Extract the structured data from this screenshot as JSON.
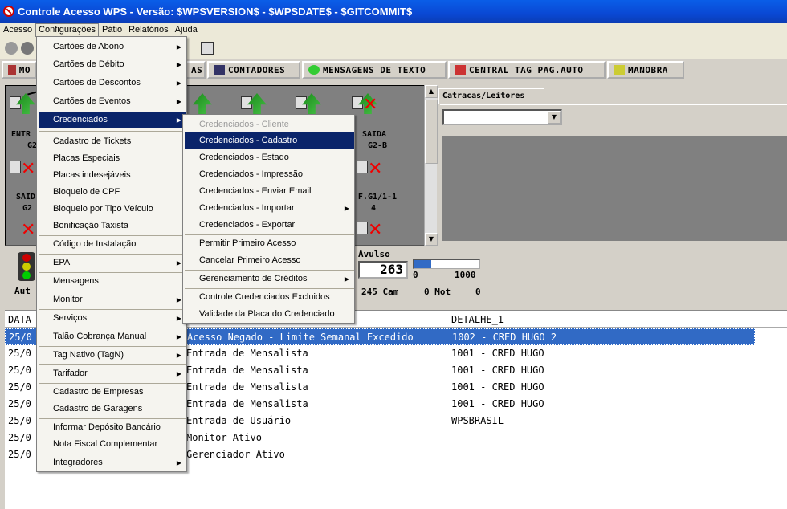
{
  "window": {
    "title": "Controle Acesso WPS - Versão: $WPSVERSION$ - $WPSDATE$ - $GITCOMMIT$"
  },
  "menubar": [
    "Acesso",
    "Configurações",
    "Pátio",
    "Relatórios",
    "Ajuda"
  ],
  "tabs": [
    {
      "label": "MO",
      "icon": "network-icon"
    },
    {
      "label": "AS",
      "icon": "none"
    },
    {
      "label": "CONTADORES",
      "icon": "counter-icon"
    },
    {
      "label": "MENSAGENS DE TEXTO",
      "icon": "message-bubble-icon"
    },
    {
      "label": "CENTRAL TAG PAG.AUTO",
      "icon": "tag-icon"
    },
    {
      "label": "MANOBRA",
      "icon": "key-icon"
    }
  ],
  "gates": {
    "labels": [
      "ENTR",
      "G2",
      "SAID",
      "G2",
      "SAIDA",
      "G2-B",
      "F.G1/1-1",
      "4",
      "Aut"
    ]
  },
  "right_panel": {
    "tab": "Catracas/Leitores",
    "select_value": ""
  },
  "status": {
    "avulso_label": "Avulso",
    "avulso_count": "263",
    "progress_min": "0",
    "progress_max": "1000",
    "progress_fraction": 0.263,
    "cam": "245 Cam",
    "mot": "0 Mot",
    "zero": "0"
  },
  "log": {
    "headers": {
      "data": "DATA",
      "detalhe": "DETALHE_1"
    },
    "rows": [
      {
        "date": "25/0",
        "event": "Acesso Negado - Limite Semanal Excedido",
        "detail": "1002 - CRED HUGO 2"
      },
      {
        "date": "25/0",
        "event": "Entrada de Mensalista",
        "detail": "1001 - CRED HUGO"
      },
      {
        "date": "25/0",
        "event": "Entrada de Mensalista",
        "detail": "1001 - CRED HUGO"
      },
      {
        "date": "25/0",
        "event": "Entrada de Mensalista",
        "detail": "1001 - CRED HUGO"
      },
      {
        "date": "25/0",
        "event": "Entrada de Mensalista",
        "detail": "1001 - CRED HUGO"
      },
      {
        "date": "25/0",
        "event": "Entrada de Usuário",
        "detail": "WPSBRASIL"
      },
      {
        "date": "25/0",
        "event": "Monitor Ativo",
        "detail": ""
      },
      {
        "date": "25/0",
        "event": "Gerenciador Ativo",
        "detail": ""
      }
    ]
  },
  "config_menu": [
    "Cartões de Abono",
    "Cartões de Débito",
    "Cartões de Descontos",
    "Cartões de Eventos",
    "Credenciados",
    "Cadastro de Tickets",
    "Placas Especiais",
    "Placas indesejáveis",
    "Bloqueio de CPF",
    "Bloqueio por Tipo Veículo",
    "Bonificação Taxista",
    "Código de Instalação",
    "EPA",
    "Mensagens",
    "Monitor",
    "Serviços",
    "Talão Cobrança Manual",
    "Tag Nativo (TagN)",
    "Tarifador",
    "Cadastro de Empresas",
    "Cadastro de Garagens",
    "Informar Depósito Bancário",
    "Nota Fiscal Complementar",
    "Integradores"
  ],
  "cred_menu": [
    "Credenciados - Cliente",
    "Credenciados - Cadastro",
    "Credenciados - Estado",
    "Credenciados - Impressão",
    "Credenciados - Enviar Email",
    "Credenciados - Importar",
    "Credenciados - Exportar",
    "Permitir Primeiro Acesso",
    "Cancelar Primeiro Acesso",
    "Gerenciamento de Créditos",
    "Controle Credenciados Excluidos",
    "Validade da Placa do Credenciado"
  ]
}
